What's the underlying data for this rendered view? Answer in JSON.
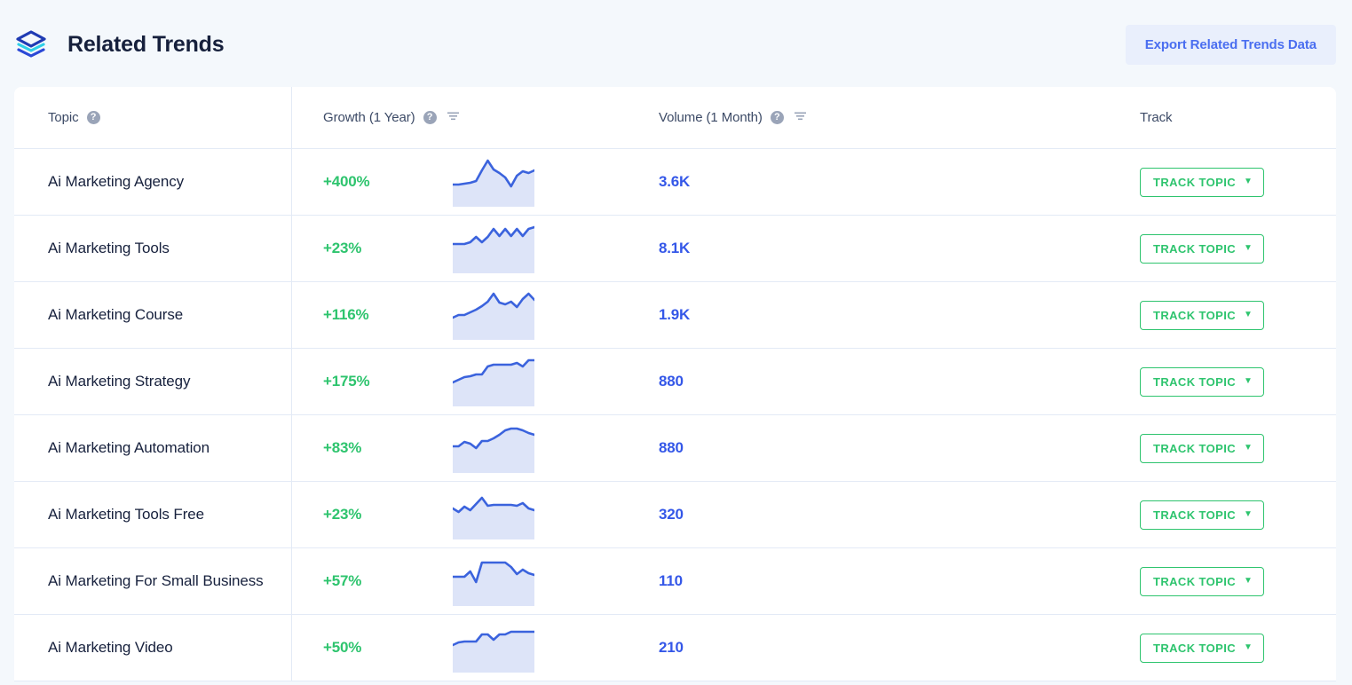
{
  "header": {
    "logo_icon": "layers-stack-icon",
    "title": "Related Trends",
    "export_label": "Export Related Trends Data"
  },
  "colors": {
    "page_bg": "#f4f8fc",
    "card_bg": "#ffffff",
    "title": "#16203c",
    "growth_green": "#2ec46e",
    "volume_blue": "#3457e8",
    "export_bg": "#e9effc",
    "export_text": "#4a6ef0",
    "spark_line": "#3b63dd",
    "spark_fill": "#dde4f8",
    "row_border": "#e3eaf6",
    "help_icon_bg": "#9aa4b8"
  },
  "table": {
    "columns": [
      {
        "key": "topic",
        "label": "Topic",
        "help": true,
        "sort": false
      },
      {
        "key": "growth",
        "label": "Growth (1 Year)",
        "help": true,
        "sort": true
      },
      {
        "key": "volume",
        "label": "Volume (1 Month)",
        "help": true,
        "sort": true
      },
      {
        "key": "track",
        "label": "Track",
        "help": false,
        "sort": false
      }
    ],
    "help_glyph": "?",
    "track_button_label": "TRACK TOPIC",
    "track_button_caret": "▼",
    "rows": [
      {
        "topic": "Ai Marketing Agency",
        "growth": "+400%",
        "volume": "3.6K",
        "track": "TRACK TOPIC",
        "spark": [
          30,
          30,
          29,
          28,
          26,
          14,
          3,
          13,
          17,
          22,
          32,
          20,
          15,
          17,
          14
        ]
      },
      {
        "topic": "Ai Marketing Tools",
        "growth": "+23%",
        "volume": "8.1K",
        "track": "TRACK TOPIC",
        "spark": [
          22,
          22,
          22,
          20,
          14,
          20,
          14,
          5,
          13,
          5,
          13,
          5,
          13,
          5,
          3
        ]
      },
      {
        "topic": "Ai Marketing Course",
        "growth": "+116%",
        "volume": "1.9K",
        "track": "TRACK TOPIC",
        "spark": [
          30,
          27,
          27,
          24,
          21,
          17,
          12,
          3,
          13,
          15,
          12,
          18,
          9,
          3,
          10
        ]
      },
      {
        "topic": "Ai Marketing Strategy",
        "growth": "+175%",
        "volume": "880",
        "track": "TRACK TOPIC",
        "spark": [
          28,
          25,
          22,
          21,
          19,
          19,
          10,
          8,
          8,
          8,
          8,
          6,
          10,
          3,
          3
        ]
      },
      {
        "topic": "Ai Marketing Automation",
        "growth": "+83%",
        "volume": "880",
        "track": "TRACK TOPIC",
        "spark": [
          25,
          25,
          20,
          22,
          27,
          19,
          19,
          16,
          12,
          7,
          5,
          5,
          7,
          10,
          12
        ]
      },
      {
        "topic": "Ai Marketing Tools Free",
        "growth": "+23%",
        "volume": "320",
        "track": "TRACK TOPIC",
        "spark": [
          20,
          24,
          18,
          22,
          15,
          8,
          17,
          16,
          16,
          16,
          16,
          17,
          14,
          20,
          22
        ]
      },
      {
        "topic": "Ai Marketing For Small Business",
        "growth": "+57%",
        "volume": "110",
        "track": "TRACK TOPIC",
        "spark": [
          22,
          22,
          22,
          16,
          28,
          6,
          6,
          6,
          6,
          6,
          11,
          19,
          14,
          18,
          20
        ]
      },
      {
        "topic": "Ai Marketing Video",
        "growth": "+50%",
        "volume": "210",
        "track": "TRACK TOPIC",
        "spark": [
          24,
          21,
          20,
          20,
          20,
          12,
          12,
          18,
          12,
          12,
          9,
          9,
          9,
          9,
          9
        ]
      }
    ]
  }
}
